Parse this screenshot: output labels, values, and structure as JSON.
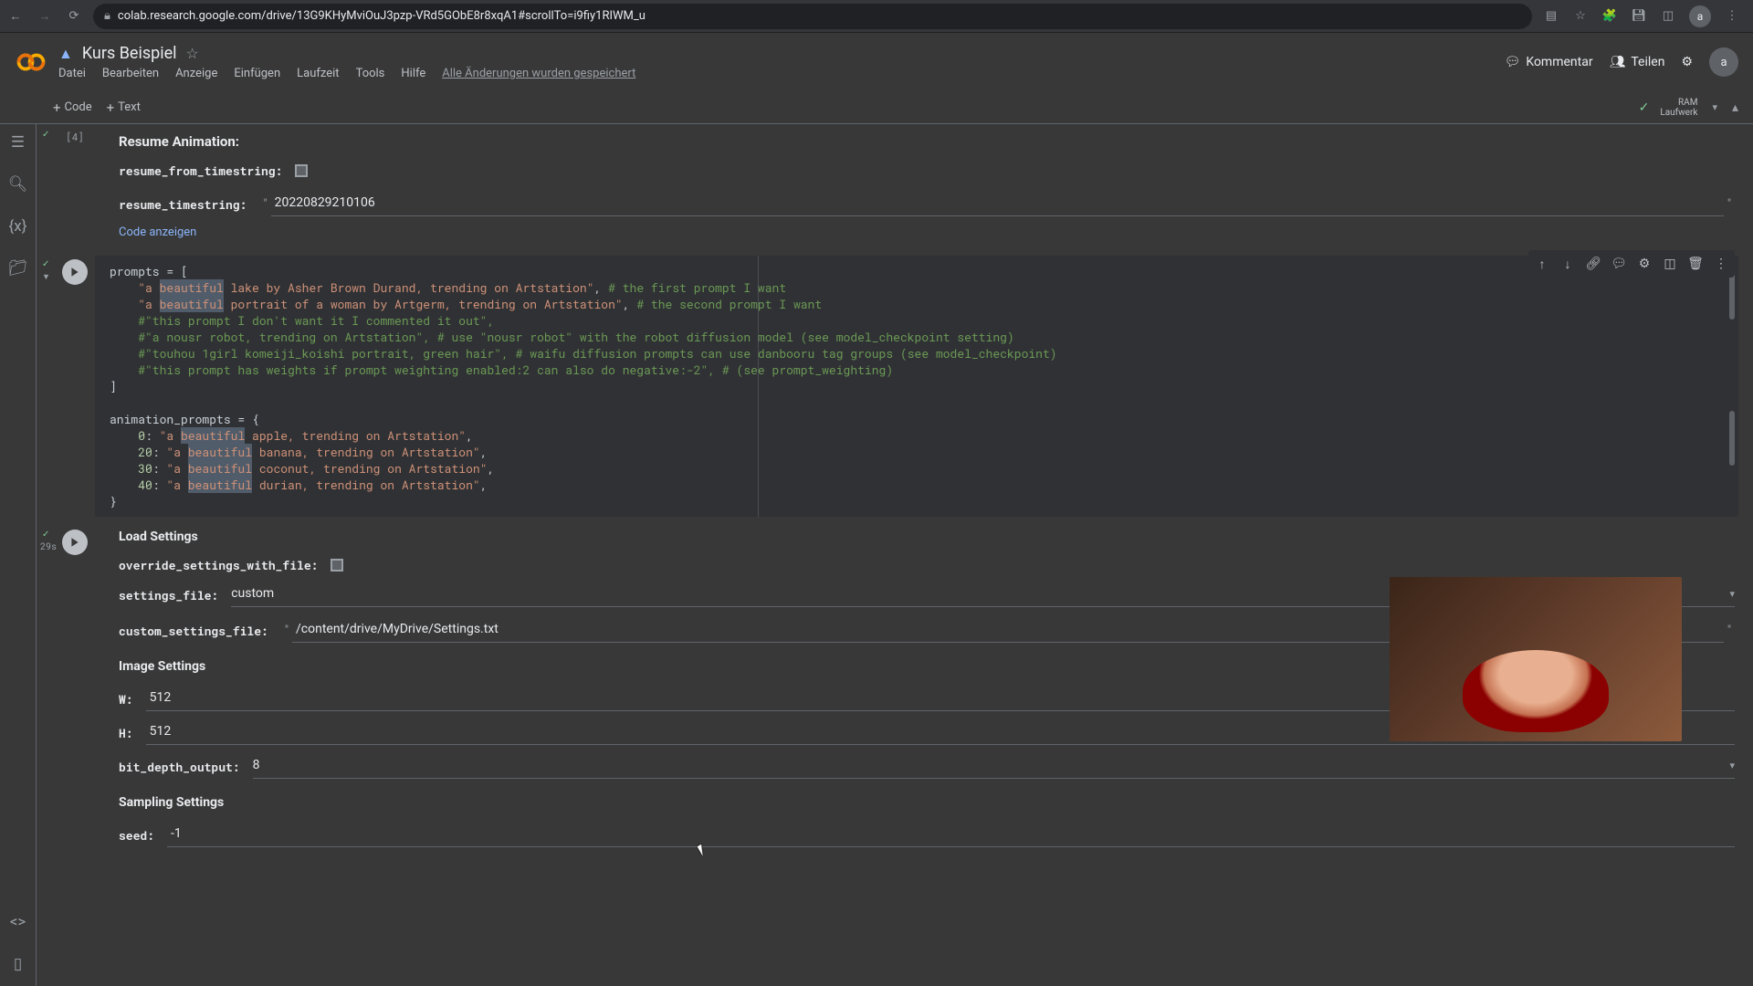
{
  "browser": {
    "url": "colab.research.google.com/drive/13G9KHyMviOuJ3pzp-VRd5GObE8r8xqA1#scrollTo=i9fiy1RIWM_u"
  },
  "header": {
    "title": "Kurs Beispiel",
    "comment": "Kommentar",
    "share": "Teilen",
    "avatar_letter": "a",
    "ram": "RAM",
    "disk": "Laufwerk"
  },
  "menu": {
    "file": "Datei",
    "edit": "Bearbeiten",
    "view": "Anzeige",
    "insert": "Einfügen",
    "runtime": "Laufzeit",
    "tools": "Tools",
    "help": "Hilfe",
    "saved": "Alle Änderungen wurden gespeichert"
  },
  "toolbar": {
    "code": "Code",
    "text": "Text"
  },
  "cell1": {
    "id": "[4]",
    "title": "Resume Animation:",
    "resume_from_label": "resume_from_timestring:",
    "resume_ts_label": "resume_timestring:",
    "resume_ts_value": "20220829210106",
    "show_code": "Code anzeigen"
  },
  "code": {
    "l1": "prompts = [",
    "l2a": "    \"a ",
    "l2b": "beautiful",
    "l2c": " lake by Asher Brown Durand, trending on Artstation\"",
    "l2d": ", ",
    "l2e": "# the first prompt I want",
    "l3a": "    \"a ",
    "l3b": "beautiful",
    "l3c": " portrait of a woman by Artgerm, trending on Artstation\"",
    "l3d": ", ",
    "l3e": "# the second prompt I want",
    "l4": "    #\"this prompt I don't want it I commented it out\",",
    "l5": "    #\"a nousr robot, trending on Artstation\", # use \"nousr robot\" with the robot diffusion model (see model_checkpoint setting)",
    "l6": "    #\"touhou 1girl komeiji_koishi portrait, green hair\", # waifu diffusion prompts can use danbooru tag groups (see model_checkpoint)",
    "l7": "    #\"this prompt has weights if prompt weighting enabled:2 can also do negative:-2\", # (see prompt_weighting)",
    "l8": "]",
    "l10": "animation_prompts = {",
    "l11a": "    0",
    "l11b": ": ",
    "l11c": "\"a ",
    "l11d": "beautiful",
    "l11e": " apple, trending on Artstation\"",
    "l11f": ",",
    "l12a": "    20",
    "l12b": ": ",
    "l12c": "\"a ",
    "l12d": "beautiful",
    "l12e": " banana, trending on Artstation\"",
    "l12f": ",",
    "l13a": "    30",
    "l13b": ": ",
    "l13c": "\"a ",
    "l13d": "beautiful",
    "l13e": " coconut, trending on Artstation\"",
    "l13f": ",",
    "l14a": "    40",
    "l14b": ": ",
    "l14c": "\"a ",
    "l14d": "beautiful",
    "l14e": " durian, trending on Artstation\"",
    "l14f": ",",
    "l15": "}"
  },
  "load": {
    "sec": "29s",
    "title": "Load Settings",
    "override_label": "override_settings_with_file:",
    "settings_file_label": "settings_file:",
    "settings_file_value": "custom",
    "custom_label": "custom_settings_file:",
    "custom_value": "/content/drive/MyDrive/Settings.txt",
    "image_title": "Image Settings",
    "w_label": "W:",
    "w_value": "512",
    "h_label": "H:",
    "h_value": "512",
    "bit_label": "bit_depth_output:",
    "bit_value": "8",
    "sampling_title": "Sampling Settings",
    "seed_label": "seed:",
    "seed_value": "-1"
  }
}
